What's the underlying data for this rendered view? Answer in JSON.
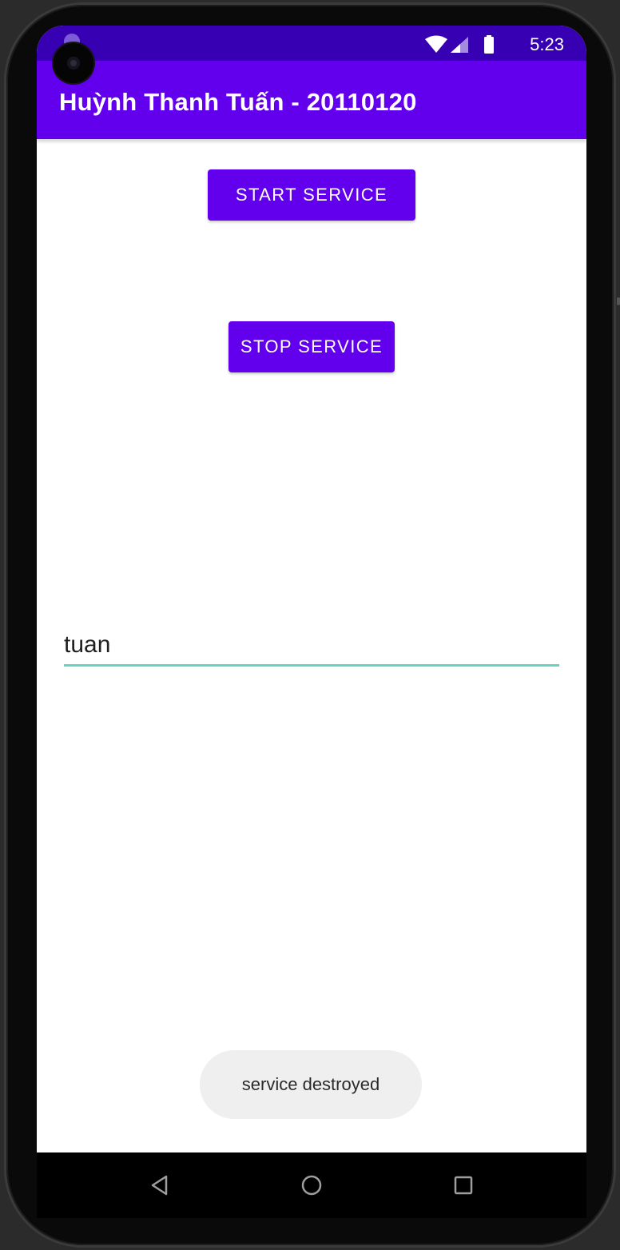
{
  "status_bar": {
    "time": "5:23",
    "icons": [
      "wifi-icon",
      "signal-icon",
      "battery-icon"
    ],
    "background": "#3700b3"
  },
  "app_bar": {
    "title": "Huỳnh Thanh Tuấn - 20110120",
    "background": "#6200ee"
  },
  "buttons": {
    "start_label": "START SERVICE",
    "stop_label": "STOP SERVICE",
    "color": "#6200ee"
  },
  "edit_text": {
    "value": "tuan",
    "underline_color": "#66d4c3"
  },
  "toast": {
    "message": "service destroyed"
  },
  "navigation": {
    "items": [
      "back-icon",
      "home-icon",
      "recents-icon"
    ]
  }
}
